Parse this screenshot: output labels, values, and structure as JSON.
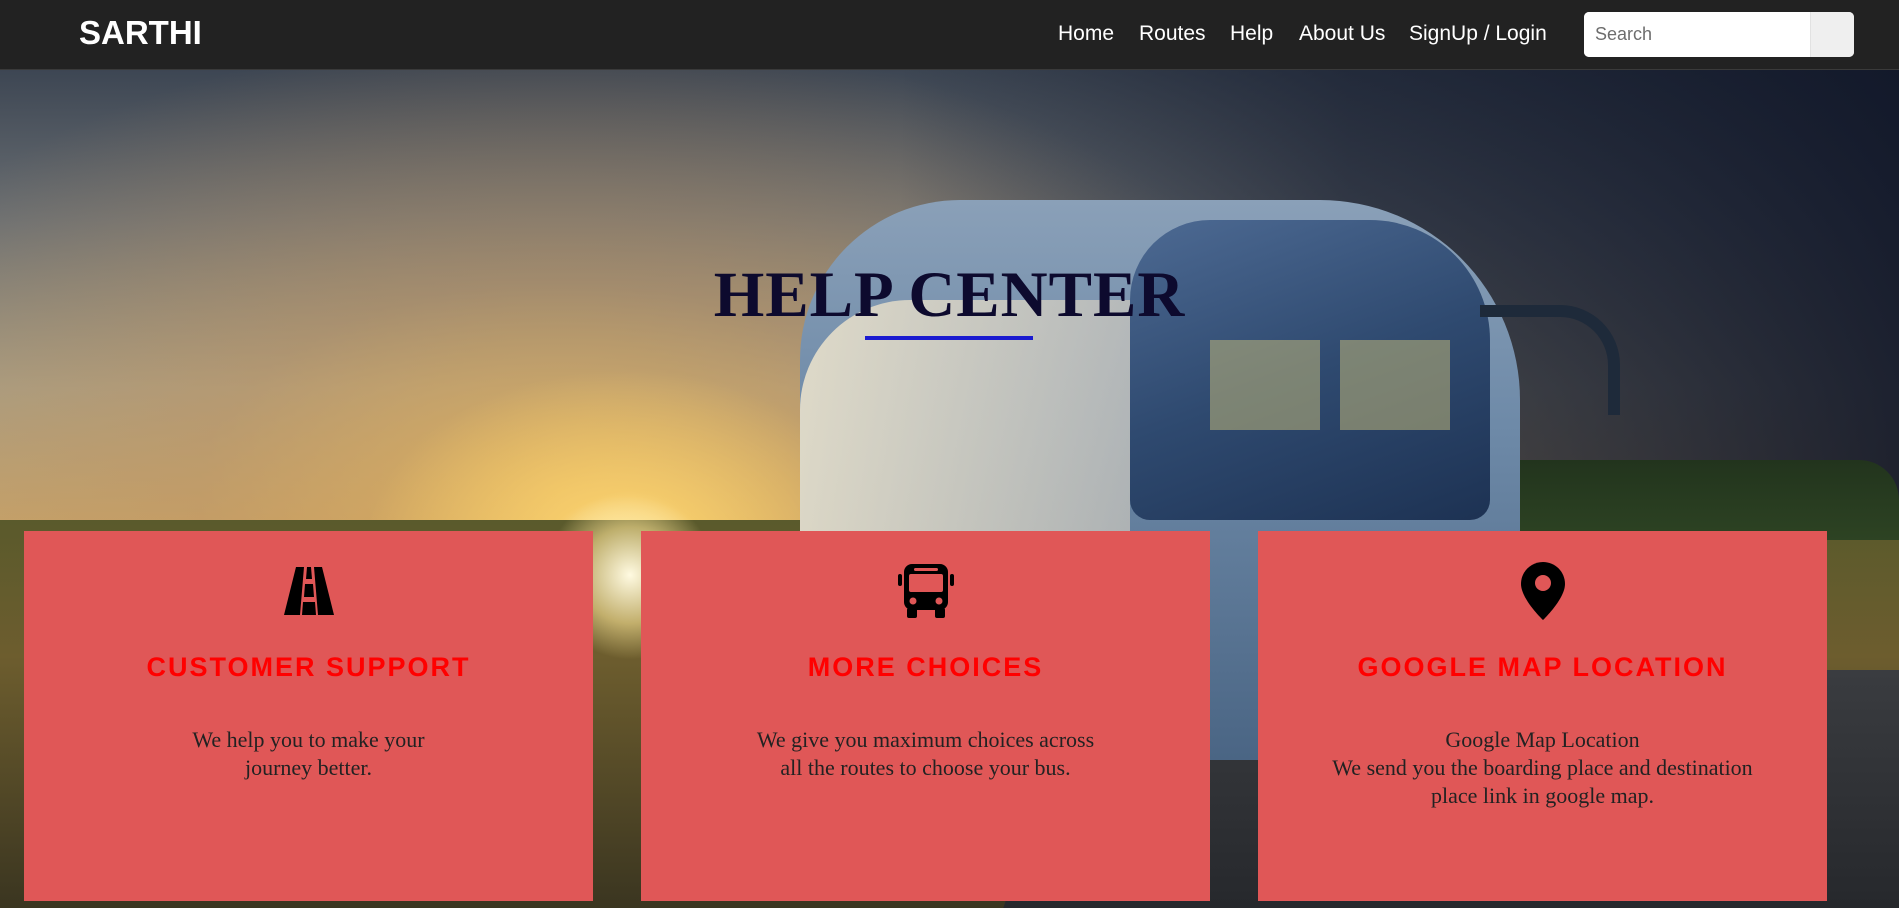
{
  "navbar": {
    "brand": "SARTHI",
    "links": [
      "Home",
      "Routes",
      "Help",
      "About Us",
      "SignUp / Login"
    ],
    "search": {
      "placeholder": "Search",
      "value": ""
    }
  },
  "hero": {
    "title": "HELP CENTER"
  },
  "cards": [
    {
      "icon": "road-icon",
      "title": "CUSTOMER SUPPORT",
      "text_lines": [
        "We help you to make your",
        "journey better."
      ]
    },
    {
      "icon": "bus-icon",
      "title": "MORE CHOICES",
      "text_lines": [
        "We give you maximum choices across",
        "all the routes to choose your bus."
      ]
    },
    {
      "icon": "map-marker-icon",
      "title": "GOOGLE MAP LOCATION",
      "text_lines": [
        "Google Map Location",
        "We send you the boarding place and destination",
        "place link in google map."
      ]
    }
  ],
  "colors": {
    "navbar_bg": "#222222",
    "card_bg": "#e05757",
    "card_title": "#ff0000",
    "hero_title": "#0d0a2e",
    "underline": "#1a1ad0"
  }
}
